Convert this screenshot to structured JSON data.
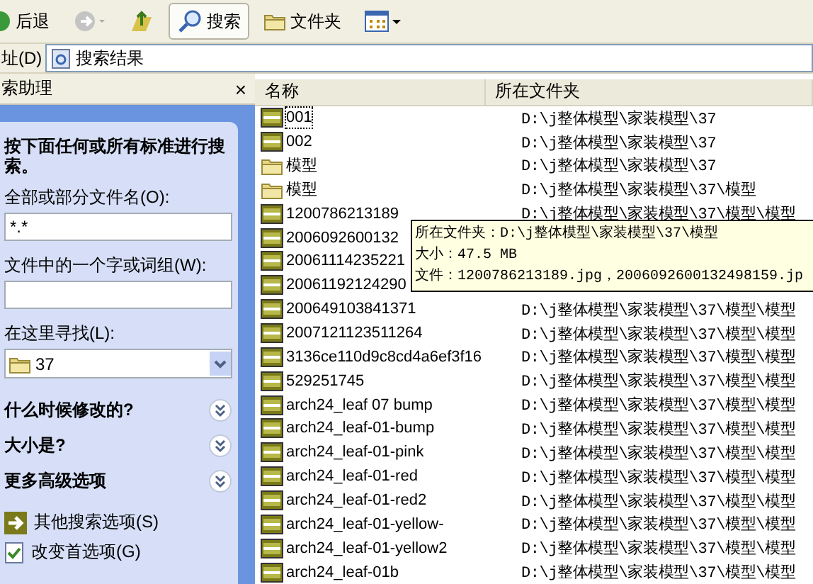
{
  "toolbar": {
    "buttons": [
      {
        "kind": "back",
        "label": "后退",
        "selected": false
      },
      {
        "kind": "forward",
        "selected": false
      },
      {
        "kind": "up",
        "selected": false
      },
      {
        "kind": "search",
        "label": "搜索",
        "selected": true
      },
      {
        "kind": "folders",
        "label": "文件夹",
        "selected": false
      },
      {
        "kind": "views",
        "selected": false
      }
    ]
  },
  "address": {
    "label": "址(D)",
    "value": "搜索结果"
  },
  "assistant": {
    "title": "索助理",
    "close": "×",
    "prompt": "按下面任何或所有标准进行搜索。",
    "fields": [
      {
        "label": "全部或部分文件名(O):",
        "value": "*.*"
      },
      {
        "label": "文件中的一个字或词组(W):"
      }
    ],
    "look_in": {
      "label": "在这里寻找(L):",
      "value": "37"
    },
    "sections": [
      {
        "label": "什么时候修改的?",
        "expanded": false
      },
      {
        "label": "大小是?",
        "expanded": false
      },
      {
        "label": "更多高级选项",
        "expanded": false
      }
    ],
    "links": [
      {
        "kind": "arrow",
        "label": "其他搜索选项(S)"
      },
      {
        "kind": "check",
        "label": "改变首选项(G)"
      }
    ]
  },
  "list": {
    "columns": [
      "名称",
      "所在文件夹"
    ],
    "rows": [
      {
        "kind": "jpg",
        "name": "001",
        "folder": "D:\\j整体模型\\家装模型\\37",
        "focused": true
      },
      {
        "kind": "jpg",
        "name": "002",
        "folder": "D:\\j整体模型\\家装模型\\37",
        "focused": false
      },
      {
        "kind": "folder",
        "name": "模型",
        "folder": "D:\\j整体模型\\家装模型\\37",
        "focused": false
      },
      {
        "kind": "folder",
        "name": "模型",
        "folder": "D:\\j整体模型\\家装模型\\37\\模型",
        "focused": false
      },
      {
        "kind": "jpg",
        "name": "1200786213189",
        "folder": "D:\\j整体模型\\家装模型\\37\\模型\\模型",
        "focused": false
      },
      {
        "kind": "jpg",
        "name": "2006092600132",
        "focused": false
      },
      {
        "kind": "jpg",
        "name": "20061114235221",
        "focused": false
      },
      {
        "kind": "jpg",
        "name": "20061192124290",
        "focused": false
      },
      {
        "kind": "jpg",
        "name": "200649103841371",
        "folder": "D:\\j整体模型\\家装模型\\37\\模型\\模型",
        "focused": false
      },
      {
        "kind": "jpg",
        "name": "2007121123511264",
        "folder": "D:\\j整体模型\\家装模型\\37\\模型\\模型",
        "focused": false
      },
      {
        "kind": "jpg",
        "name": "3136ce110d9c8cd4a6ef3f16",
        "folder": "D:\\j整体模型\\家装模型\\37\\模型\\模型",
        "focused": false
      },
      {
        "kind": "jpg",
        "name": "529251745",
        "folder": "D:\\j整体模型\\家装模型\\37\\模型\\模型",
        "focused": false
      },
      {
        "kind": "jpg",
        "name": "arch24_leaf 07 bump",
        "folder": "D:\\j整体模型\\家装模型\\37\\模型\\模型",
        "focused": false
      },
      {
        "kind": "jpg",
        "name": "arch24_leaf-01-bump",
        "folder": "D:\\j整体模型\\家装模型\\37\\模型\\模型",
        "focused": false
      },
      {
        "kind": "jpg",
        "name": "arch24_leaf-01-pink",
        "folder": "D:\\j整体模型\\家装模型\\37\\模型\\模型",
        "focused": false
      },
      {
        "kind": "jpg",
        "name": "arch24_leaf-01-red",
        "folder": "D:\\j整体模型\\家装模型\\37\\模型\\模型",
        "focused": false
      },
      {
        "kind": "jpg",
        "name": "arch24_leaf-01-red2",
        "folder": "D:\\j整体模型\\家装模型\\37\\模型\\模型",
        "focused": false
      },
      {
        "kind": "jpg",
        "name": "arch24_leaf-01-yellow-",
        "folder": "D:\\j整体模型\\家装模型\\37\\模型\\模型",
        "focused": false
      },
      {
        "kind": "jpg",
        "name": "arch24_leaf-01-yellow2",
        "folder": "D:\\j整体模型\\家装模型\\37\\模型\\模型",
        "focused": false
      },
      {
        "kind": "jpg",
        "name": "arch24_leaf-01b",
        "folder": "D:\\j整体模型\\家装模型\\37\\模型\\模型",
        "focused": false
      }
    ]
  },
  "tooltip": {
    "lines": [
      "所在文件夹：D:\\j整体模型\\家装模型\\37\\模型",
      "大小：47.5 MB",
      "文件：1200786213189.jpg，2006092600132498159.jp"
    ]
  }
}
